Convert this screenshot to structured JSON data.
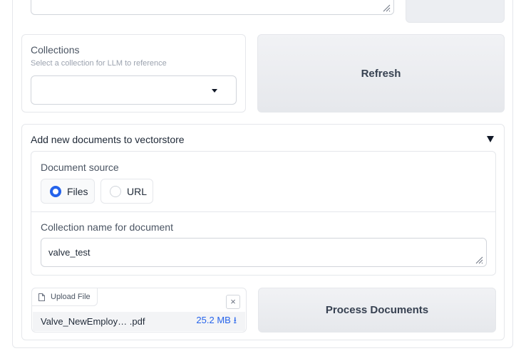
{
  "top_textarea": {
    "value": ""
  },
  "collections": {
    "label": "Collections",
    "info": "Select a collection for LLM to reference",
    "selected_value": ""
  },
  "refresh_button": {
    "label": "Refresh"
  },
  "add_documents": {
    "title": "Add new documents to vectorstore",
    "expanded": true,
    "document_source": {
      "label": "Document source",
      "options": [
        "Files",
        "URL"
      ],
      "selected": "Files"
    },
    "collection_name": {
      "label": "Collection name for document",
      "value": "valve_test"
    },
    "upload": {
      "label": "Upload File",
      "clear_symbol": "×",
      "file": {
        "name": "Valve_NewEmploy… .pdf",
        "size": "25.2 MB ⭳"
      }
    },
    "process_button": {
      "label": "Process Documents"
    }
  },
  "colors": {
    "accent": "#2563eb",
    "button_bg": "#eceef2",
    "border": "#e5e7eb"
  }
}
